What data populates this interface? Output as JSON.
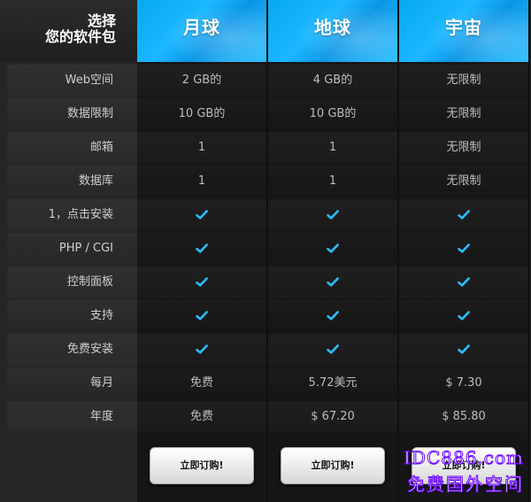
{
  "header": {
    "line1": "选择",
    "line2": "您的软件包",
    "plans": [
      "月球",
      "地球",
      "宇宙"
    ]
  },
  "rows": [
    {
      "label": "Web空间",
      "values": [
        "2 GB的",
        "4 GB的",
        "无限制"
      ]
    },
    {
      "label": "数据限制",
      "values": [
        "10 GB的",
        "10 GB的",
        "无限制"
      ]
    },
    {
      "label": "邮箱",
      "values": [
        "1",
        "1",
        "无限制"
      ]
    },
    {
      "label": "数据库",
      "values": [
        "1",
        "1",
        "无限制"
      ]
    },
    {
      "label": "1，点击安装",
      "values": [
        "✓",
        "✓",
        "✓"
      ]
    },
    {
      "label": "PHP / CGI",
      "values": [
        "✓",
        "✓",
        "✓"
      ]
    },
    {
      "label": "控制面板",
      "values": [
        "✓",
        "✓",
        "✓"
      ]
    },
    {
      "label": "支持",
      "values": [
        "✓",
        "✓",
        "✓"
      ]
    },
    {
      "label": "免费安装",
      "values": [
        "✓",
        "✓",
        "✓"
      ]
    },
    {
      "label": "每月",
      "values": [
        "免费",
        "5.72美元",
        "$ 7.30"
      ]
    },
    {
      "label": "年度",
      "values": [
        "免费",
        "$ 67.20",
        "$ 85.80"
      ]
    }
  ],
  "actions": {
    "order_label": "立即订购!"
  },
  "watermark": {
    "domain": "IDC886.com",
    "tagline": "免费国外空间"
  },
  "colors": {
    "accent": "#00aaff",
    "check": "#2dbdfc"
  }
}
